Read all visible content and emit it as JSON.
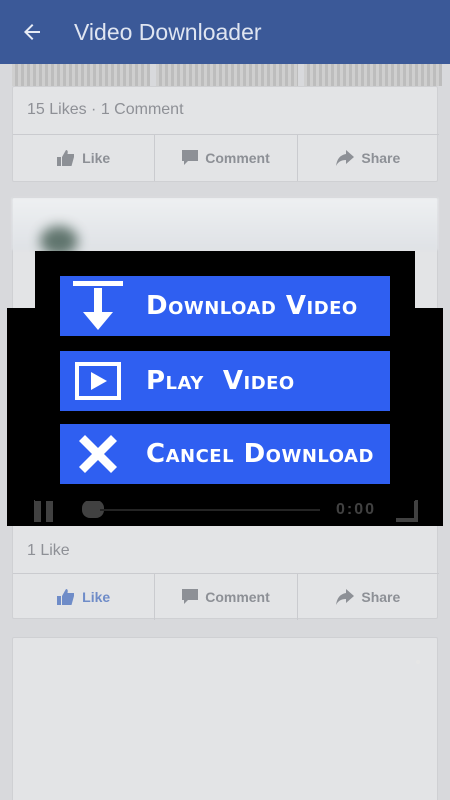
{
  "app_bar": {
    "title": "Video Downloader",
    "back_icon": "arrow-back-icon"
  },
  "post1": {
    "stats": "15 Likes · 1 Comment",
    "actions": {
      "like": "Like",
      "comment": "Comment",
      "share": "Share"
    }
  },
  "post2": {
    "stats": "1 Like",
    "actions": {
      "like": "Like",
      "comment": "Comment",
      "share": "Share"
    }
  },
  "dialog": {
    "options": [
      {
        "label": "Download Video",
        "icon": "download-icon"
      },
      {
        "label": "Play  Video",
        "icon": "play-icon"
      },
      {
        "label": "Cancel Download",
        "icon": "cancel-icon"
      }
    ]
  },
  "video_player": {
    "time": "0:00"
  },
  "colors": {
    "app_bar": "#3b5998",
    "option_button": "#2f5ff1",
    "dialog_bg": "#000000",
    "liked": "#6f8cc8"
  }
}
